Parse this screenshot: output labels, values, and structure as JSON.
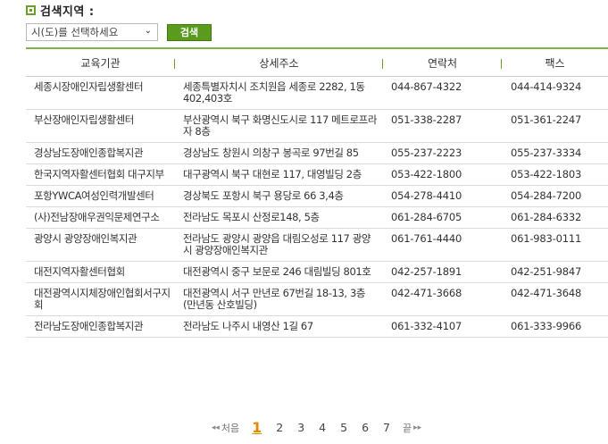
{
  "header": {
    "title": "검색지역 :"
  },
  "search": {
    "select_value": "시(도)를 선택하세요",
    "button_label": "검색"
  },
  "table": {
    "columns": [
      "교육기관",
      "상세주소",
      "연락처",
      "팩스"
    ],
    "rows": [
      [
        "세종시장애인자립생활센터",
        "세종특별자치시 조치원읍 세종로 2282, 1동 402,403호",
        "044-867-4322",
        "044-414-9324"
      ],
      [
        "부산장애인자립생활센터",
        "부산광역시 북구 화명신도시로 117 메트로프라자 8층",
        "051-338-2287",
        "051-361-2247"
      ],
      [
        "경상남도장애인종합복지관",
        "경상남도 창원시 의창구 봉곡로 97번길 85",
        "055-237-2223",
        "055-237-3334"
      ],
      [
        "한국지역자활센터협회 대구지부",
        "대구광역시 북구 대현로 117, 대영빌딩 2층",
        "053-422-1800",
        "053-422-1803"
      ],
      [
        "포항YWCA여성인력개발센터",
        "경상북도 포항시 북구 용당로 66 3,4층",
        "054-278-4410",
        "054-284-7200"
      ],
      [
        "(사)전남장애우권익문제연구소",
        "전라남도 목포시 산정로148, 5층",
        "061-284-6705",
        "061-284-6332"
      ],
      [
        "광양시 광양장애인복지관",
        "전라남도 광양시 광양읍 대림오성로 117 광양시 광양장애인복지관",
        "061-761-4440",
        "061-983-0111"
      ],
      [
        "대전지역자활센터협회",
        "대전광역시 중구 보문로 246 대림빌딩 801호",
        "042-257-1891",
        "042-251-9847"
      ],
      [
        "대전광역시지체장애인협회서구지회",
        "대전광역시 서구 만년로 67번길 18-13, 3층 (만년동 산호빌딩)",
        "042-471-3668",
        "042-471-3648"
      ],
      [
        "전라남도장애인종합복지관",
        "전라남도 나주시 내영산 1길 67",
        "061-332-4107",
        "061-333-9966"
      ]
    ]
  },
  "pagination": {
    "prev_label": "처음",
    "next_label": "끝",
    "pages": [
      "1",
      "2",
      "3",
      "4",
      "5",
      "6",
      "7"
    ],
    "current": "1"
  },
  "colors": {
    "accent": "#6aa02b",
    "button": "#5a9a1c",
    "active_page": "#e08a00"
  }
}
